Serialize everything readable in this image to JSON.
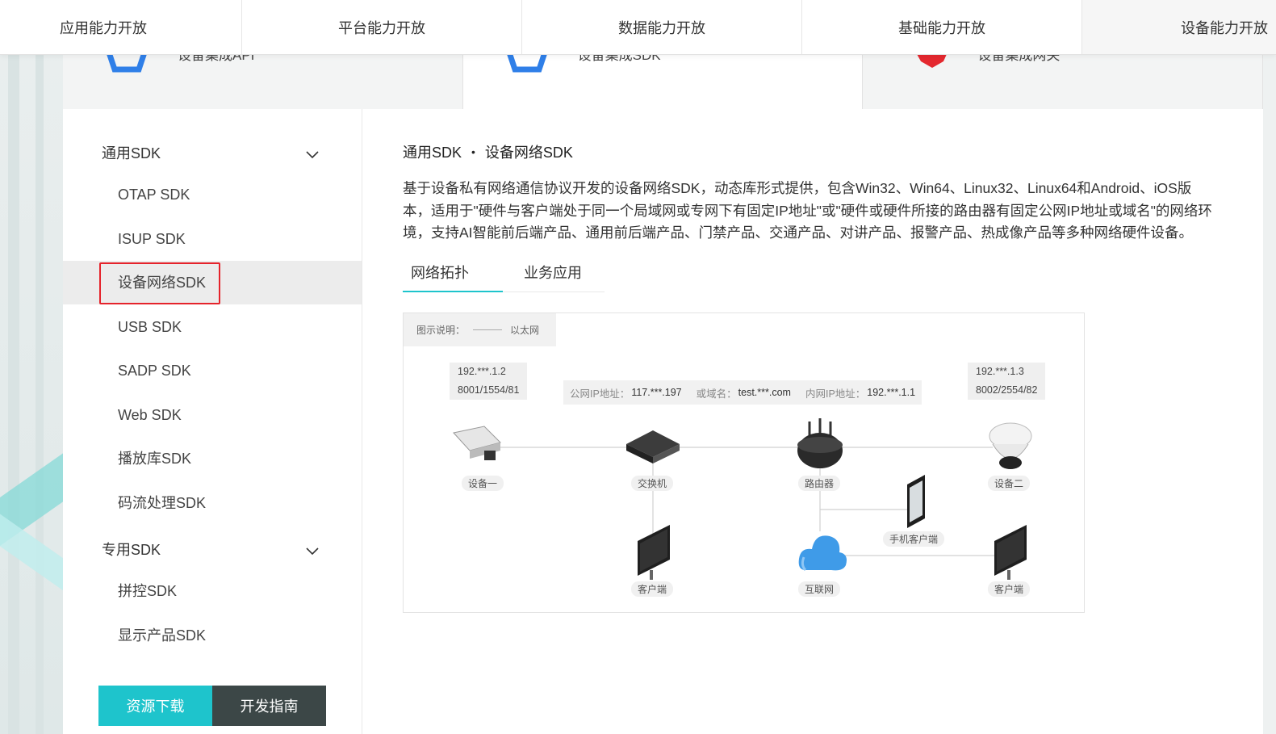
{
  "topnav": {
    "tabs": [
      "应用能力开放",
      "平台能力开放",
      "数据能力开放",
      "基础能力开放",
      "设备能力开放"
    ]
  },
  "product_strip": {
    "items": [
      {
        "label": "设备集成API",
        "icon": "api-icon"
      },
      {
        "label": "设备集成SDK",
        "icon": "sdk-icon"
      },
      {
        "label": "设备集成网关",
        "icon": "gateway-icon"
      }
    ]
  },
  "sidebar": {
    "group1": "通用SDK",
    "group1_items": [
      "OTAP SDK",
      "ISUP SDK",
      "设备网络SDK",
      "USB SDK",
      "SADP SDK",
      "Web SDK",
      "播放库SDK",
      "码流处理SDK"
    ],
    "group2": "专用SDK",
    "group2_items": [
      "拼控SDK",
      "显示产品SDK"
    ],
    "selected": "设备网络SDK",
    "btn_download": "资源下载",
    "btn_guide": "开发指南"
  },
  "main": {
    "crumb_parent": "通用SDK",
    "crumb_sep": "•",
    "crumb_current": "设备网络SDK",
    "description": "基于设备私有网络通信协议开发的设备网络SDK，动态库形式提供，包含Win32、Win64、Linux32、Linux64和Android、iOS版本，适用于\"硬件与客户端处于同一个局域网或专网下有固定IP地址\"或\"硬件或硬件所接的路由器有固定公网IP地址或域名\"的网络环境，支持AI智能前后端产品、通用前后端产品、门禁产品、交通产品、对讲产品、报警产品、热成像产品等多种网络硬件设备。",
    "tabs": [
      "网络拓扑",
      "业务应用"
    ],
    "active_tab": "网络拓扑"
  },
  "diagram": {
    "legend_label": "图示说明：",
    "legend_item": "以太网",
    "device1_ip": "192.***.1.2",
    "device1_ports": "8001/1554/81",
    "device2_ip": "192.***.1.3",
    "device2_ports": "8002/2554/82",
    "public_ip_label": "公网IP地址：",
    "public_ip": "117.***.197",
    "domain_label": "或域名：",
    "domain": "test.***.com",
    "lan_ip_label": "内网IP地址：",
    "lan_ip": "192.***.1.1",
    "nodes": {
      "device1": "设备一",
      "switch": "交换机",
      "router": "路由器",
      "device2": "设备二",
      "mobile": "手机客户端",
      "client1": "客户端",
      "internet": "互联网",
      "client2": "客户端"
    }
  },
  "colors": {
    "accent": "#1ec4cc",
    "dark_button": "#3c4747",
    "selection_outline": "#e5232b"
  }
}
